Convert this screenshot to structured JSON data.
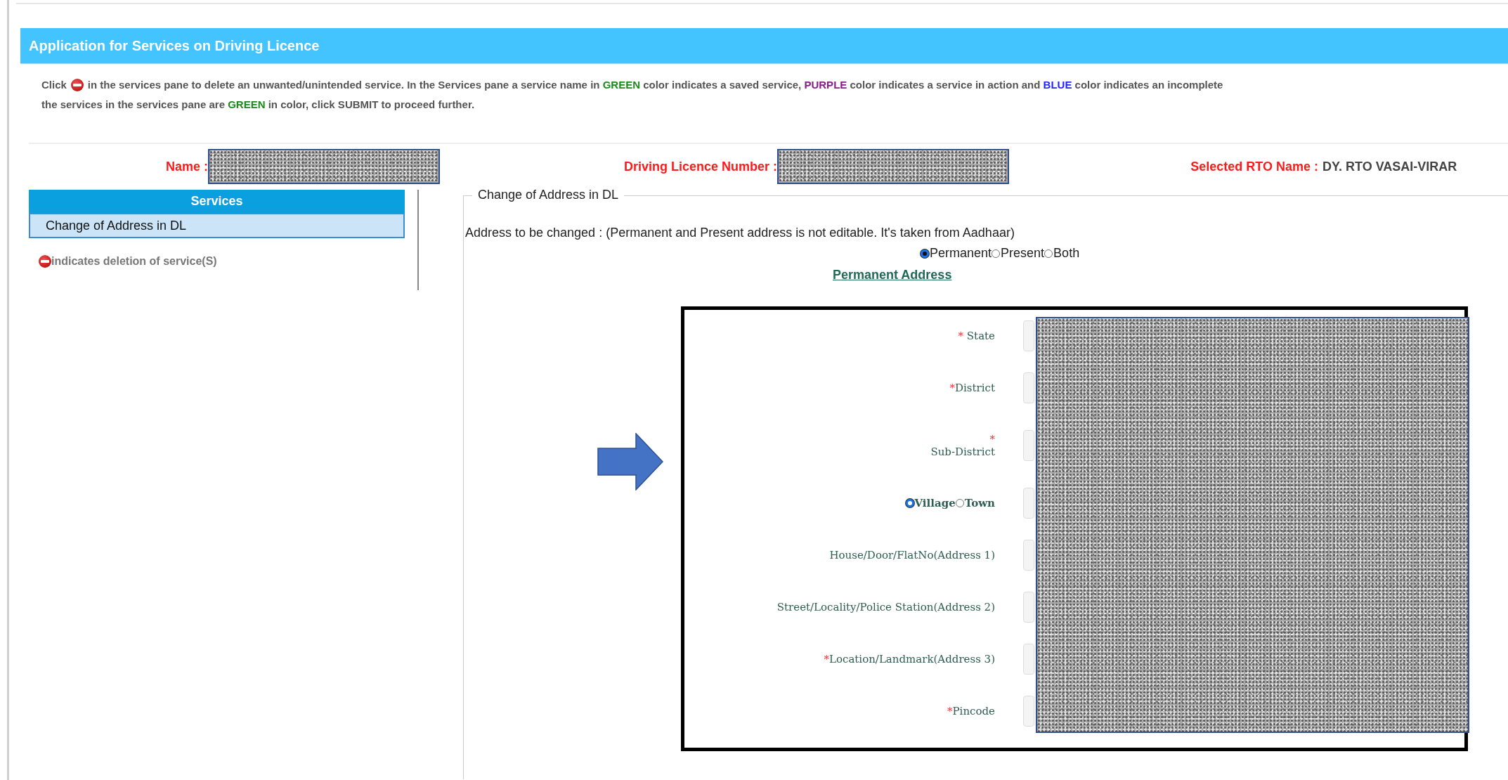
{
  "header": {
    "title": "Application for Services on Driving Licence"
  },
  "instructions": {
    "line_1": {
      "before_icon": "Click",
      "segments": [
        {
          "text": " in the services pane to delete an unwanted/unintended service. In the Services pane a service name in ",
          "color": "#555555"
        },
        {
          "text": "GREEN",
          "color": "#1a8a1a"
        },
        {
          "text": " color indicates a saved service, ",
          "color": "#555555"
        },
        {
          "text": "PURPLE",
          "color": "#8b1a8b"
        },
        {
          "text": " color indicates a service in action and ",
          "color": "#555555"
        },
        {
          "text": "BLUE",
          "color": "#2323ff"
        },
        {
          "text": " color indicates an incomplete",
          "color": "#555555"
        }
      ]
    },
    "line_2": {
      "segments": [
        {
          "text": "the services in the services pane are ",
          "color": "#555555"
        },
        {
          "text": "GREEN",
          "color": "#1a8a1a"
        },
        {
          "text": " in color, click SUBMIT to proceed further.",
          "color": "#555555"
        }
      ]
    }
  },
  "applicant": {
    "name_label": "Name :",
    "licence_label": "Driving Licence Number :",
    "rto_label": "Selected RTO Name :",
    "rto_value": "DY. RTO VASAI-VIRAR"
  },
  "services": {
    "heading": "Services",
    "items": [
      {
        "label": "Change of Address in DL",
        "selected": true
      }
    ],
    "deletion_note": "indicates deletion of service(S)"
  },
  "form": {
    "legend": "Change of Address in DL",
    "note": "Address to be changed : (Permanent and Present address is not editable. It's taken from Aadhaar)",
    "address_types": [
      {
        "label": "Permanent",
        "selected": true
      },
      {
        "label": "Present",
        "selected": false
      },
      {
        "label": "Both",
        "selected": false
      }
    ],
    "section_link": "Permanent Address",
    "fields": [
      {
        "kind": "inline",
        "marker": "* ",
        "label": "State"
      },
      {
        "kind": "inline",
        "marker": "*",
        "label": "District"
      },
      {
        "kind": "stacked",
        "marker": "*",
        "label": "Sub-District"
      },
      {
        "kind": "radio",
        "options": [
          {
            "label": "Village",
            "selected": true
          },
          {
            "label": "Town",
            "selected": false
          }
        ]
      },
      {
        "kind": "inline",
        "label": "House/Door/FlatNo(Address 1)"
      },
      {
        "kind": "inline",
        "label": "Street/Locality/Police Station(Address 2)"
      },
      {
        "kind": "inline",
        "marker": "*",
        "label": "Location/Landmark(Address 3)"
      },
      {
        "kind": "inline",
        "marker": "*",
        "label": "Pincode"
      }
    ]
  }
}
